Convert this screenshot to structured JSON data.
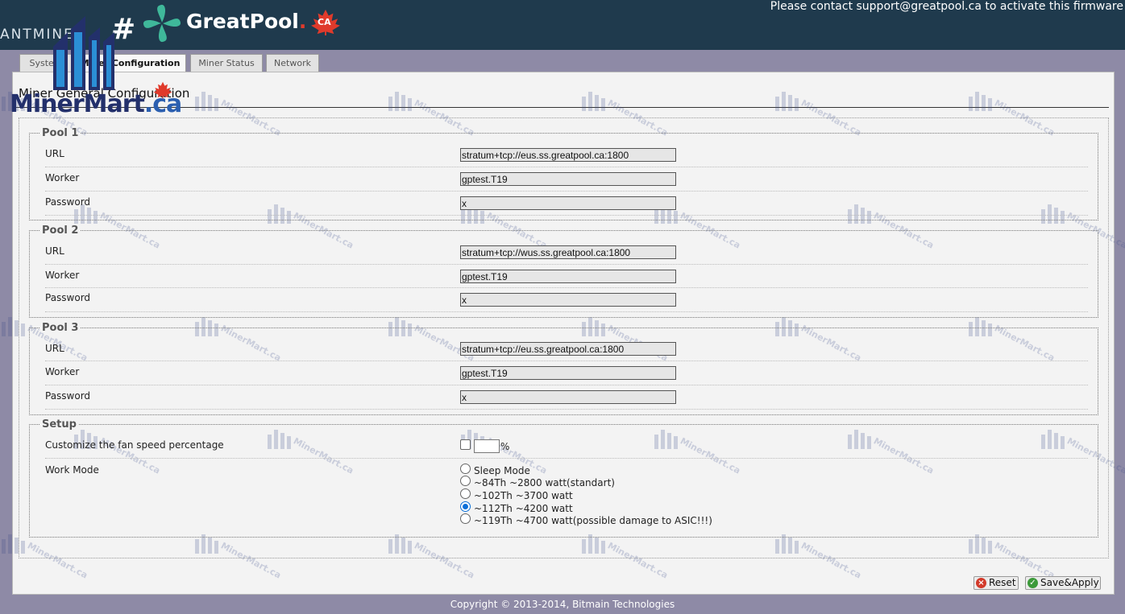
{
  "header": {
    "brand_antminer": "ANTMINER",
    "hash_sign": "#",
    "greatpool_name": "GreatPool",
    "greatpool_dot": ".",
    "greatpool_badge": "CA",
    "notice": "Please contact support@greatpool.ca to activate this firmware"
  },
  "tabs": [
    {
      "label": "System",
      "active": false
    },
    {
      "label": "Miner Configuration",
      "active": true
    },
    {
      "label": "Miner Status",
      "active": false
    },
    {
      "label": "Network",
      "active": false
    }
  ],
  "page_title": "Miner General Configuration",
  "pools": [
    {
      "title": "Pool 1",
      "url_label": "URL",
      "url_value": "stratum+tcp://eus.ss.greatpool.ca:1800",
      "worker_label": "Worker",
      "worker_value": "gptest.T19",
      "password_label": "Password",
      "password_value": "x"
    },
    {
      "title": "Pool 2",
      "url_label": "URL",
      "url_value": "stratum+tcp://wus.ss.greatpool.ca:1800",
      "worker_label": "Worker",
      "worker_value": "gptest.T19",
      "password_label": "Password",
      "password_value": "x"
    },
    {
      "title": "Pool 3",
      "url_label": "URL",
      "url_value": "stratum+tcp://eu.ss.greatpool.ca:1800",
      "worker_label": "Worker",
      "worker_value": "gptest.T19",
      "password_label": "Password",
      "password_value": "x"
    }
  ],
  "setup": {
    "title": "Setup",
    "fan_label": "Customize the fan speed percentage",
    "fan_checked": false,
    "fan_value": "",
    "fan_unit": "%",
    "work_mode_label": "Work Mode",
    "work_modes": [
      {
        "label": "Sleep Mode",
        "checked": false
      },
      {
        "label": "~84Th ~2800 watt(standart)",
        "checked": false
      },
      {
        "label": "~102Th ~3700 watt",
        "checked": false
      },
      {
        "label": "~112Th ~4200 watt",
        "checked": true
      },
      {
        "label": "~119Th ~4700 watt(possible damage to ASIC!!!)",
        "checked": false
      }
    ]
  },
  "buttons": {
    "reset": "Reset",
    "save_apply": "Save&Apply"
  },
  "footer": "Copyright © 2013-2014, Bitmain Technologies",
  "overlay": {
    "logo_text_1": "MinerMart",
    "logo_text_2": ".ca",
    "watermark_text": "MinerMart.ca"
  },
  "colors": {
    "header_bg": "#1f3a4d",
    "page_bg": "#8e8aa6",
    "greatpool_green": "#3fb89a",
    "accent_red": "#e03a2b",
    "radio_checked": "#0a6fd8",
    "mm_navy": "#23306b",
    "mm_blue": "#2b8fd6"
  },
  "icons": {
    "greatpool_logo": "clover-icon",
    "badge": "maple-leaf-icon",
    "reset": "reset-x-icon",
    "save": "save-check-icon"
  }
}
